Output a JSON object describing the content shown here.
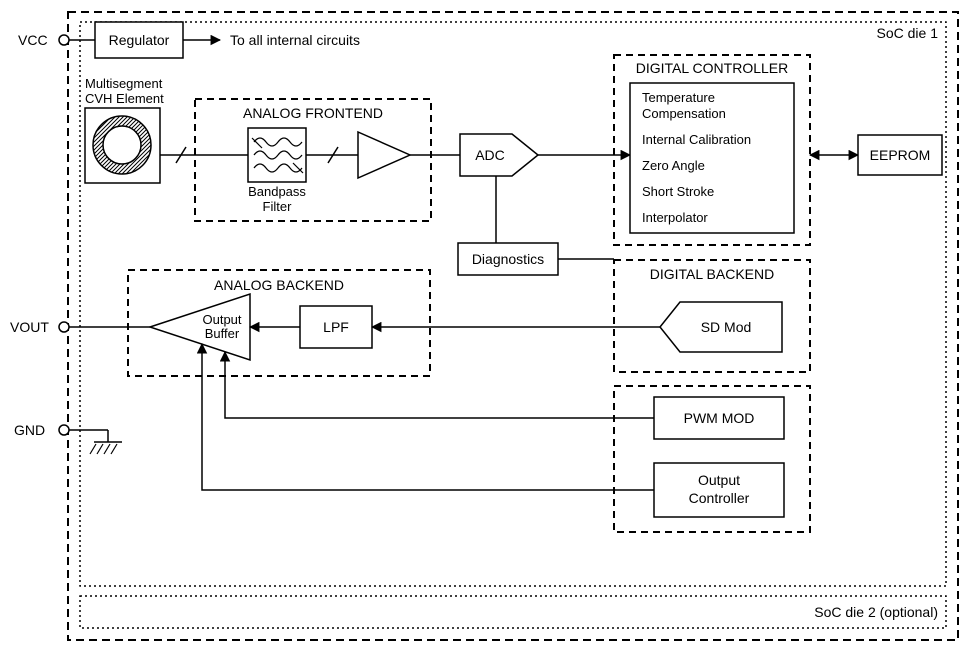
{
  "pins": {
    "vcc": "VCC",
    "vout": "VOUT",
    "gnd": "GND"
  },
  "dies": {
    "die1": "SoC die 1",
    "die2": "SoC die 2 (optional)"
  },
  "blocks": {
    "regulator": "Regulator",
    "regulator_note": "To all internal circuits",
    "cvh_title1": "Multisegment",
    "cvh_title2": "CVH Element",
    "analog_frontend_title": "ANALOG FRONTEND",
    "bandpass_label1": "Bandpass",
    "bandpass_label2": "Filter",
    "adc": "ADC",
    "diagnostics": "Diagnostics",
    "digital_controller_title": "DIGITAL CONTROLLER",
    "dc_items": {
      "temp_comp": "Temperature",
      "temp_comp2": "Compensation",
      "int_cal": "Internal Calibration",
      "zero_angle": "Zero Angle",
      "short_stroke": "Short Stroke",
      "interpolator": "Interpolator"
    },
    "eeprom": "EEPROM",
    "digital_backend_title": "DIGITAL BACKEND",
    "sd_mod": "SD Mod",
    "pwm_mod": "PWM MOD",
    "output_ctrl1": "Output",
    "output_ctrl2": "Controller",
    "analog_backend_title": "ANALOG BACKEND",
    "lpf": "LPF",
    "out_buf1": "Output",
    "out_buf2": "Buffer"
  }
}
